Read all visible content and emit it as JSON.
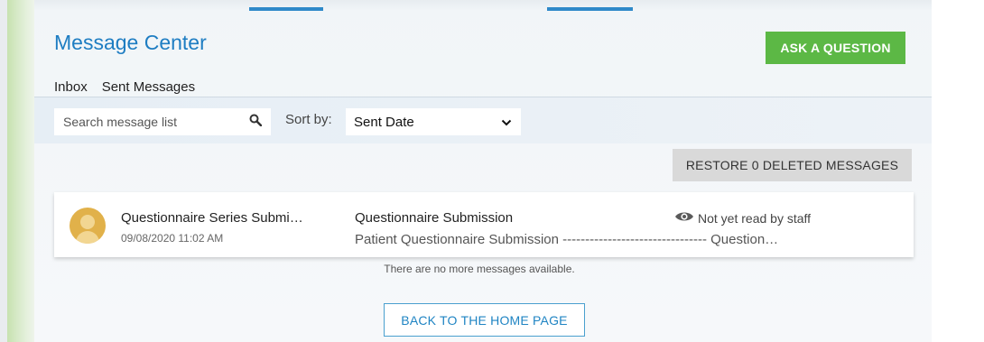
{
  "colors": {
    "accent_blue": "#1e7dc2",
    "ask_green": "#5cb845",
    "restore_gray": "#d9d9d9",
    "home_border": "#4aa0cf"
  },
  "header": {
    "title": "Message Center",
    "ask_button": "ASK A QUESTION"
  },
  "tabs": [
    {
      "label": "Inbox",
      "active": false
    },
    {
      "label": "Sent Messages",
      "active": true
    }
  ],
  "filters": {
    "search_placeholder": "Search message list",
    "search_icon": "search-icon",
    "sort_label": "Sort by:",
    "sort_value": "Sent Date",
    "sort_icon": "chevron-down-icon"
  },
  "restore_button": "RESTORE 0 DELETED MESSAGES",
  "messages": [
    {
      "subject": "Questionnaire Series Submi…",
      "date": "09/08/2020 11:02 AM",
      "title": "Questionnaire Submission",
      "preview": "Patient Questionnaire Submission -------------------------------- Question…",
      "status_icon": "eye-icon",
      "status": "Not yet read by staff"
    }
  ],
  "footer": {
    "no_more_text": "There are no more messages available.",
    "home_button": "BACK TO THE HOME PAGE"
  }
}
